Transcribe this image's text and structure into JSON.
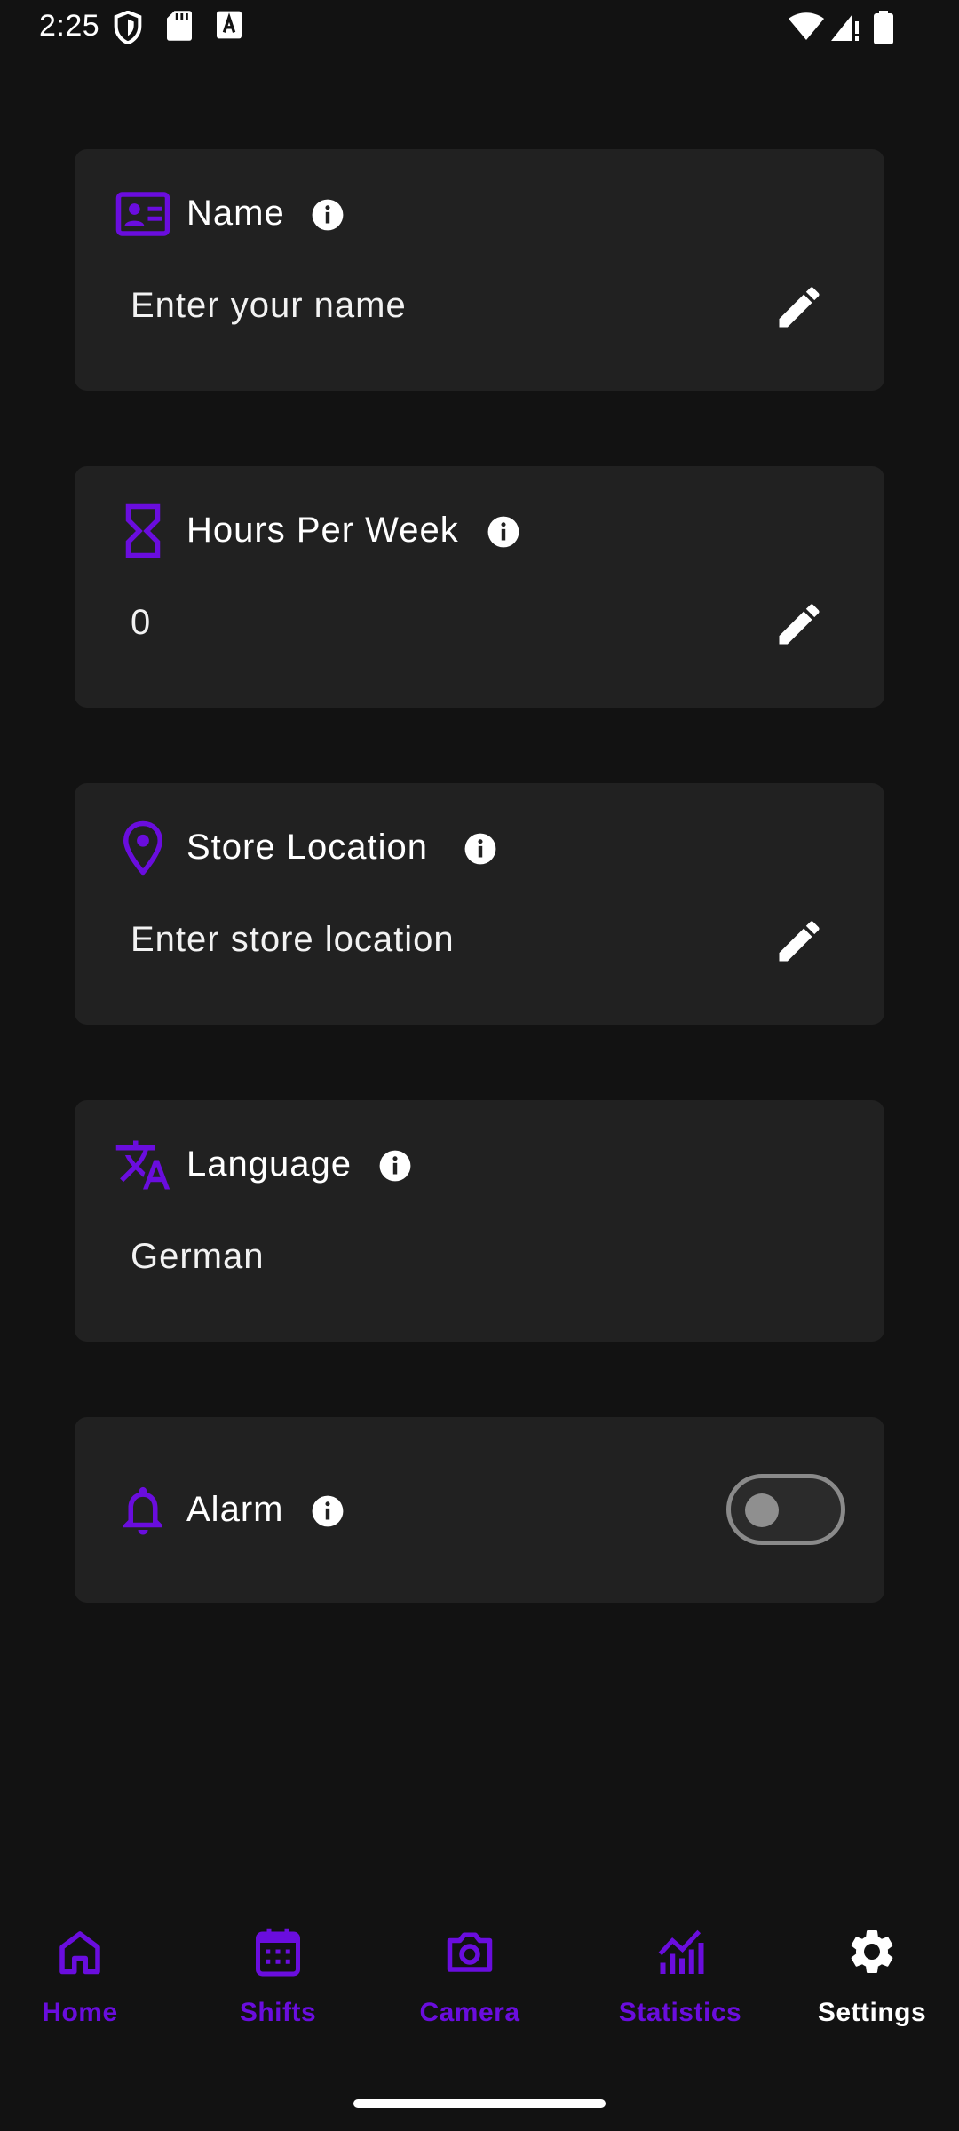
{
  "status_bar": {
    "time": "2:25",
    "left_icons": [
      "shield-icon",
      "sd-card-icon",
      "keyboard-a-icon"
    ],
    "right_icons": [
      "wifi-icon",
      "signal-icon",
      "battery-icon"
    ]
  },
  "colors": {
    "accent": "#6a0dde",
    "card_bg": "#212121",
    "background": "#121212",
    "selected_nav": "#ffffff"
  },
  "settings": {
    "name": {
      "icon": "id-card-icon",
      "title": "Name",
      "value": "Enter your name"
    },
    "hours": {
      "icon": "hourglass-icon",
      "title": "Hours Per Week",
      "value": "0"
    },
    "store": {
      "icon": "location-pin-icon",
      "title": "Store Location",
      "value": "Enter store location"
    },
    "language": {
      "icon": "translate-icon",
      "title": "Language",
      "value": "German"
    },
    "alarm": {
      "icon": "bell-icon",
      "title": "Alarm",
      "enabled": false
    }
  },
  "nav": {
    "items": [
      {
        "label": "Home",
        "icon": "home-icon",
        "selected": false
      },
      {
        "label": "Shifts",
        "icon": "calendar-icon",
        "selected": false
      },
      {
        "label": "Camera",
        "icon": "camera-icon",
        "selected": false
      },
      {
        "label": "Statistics",
        "icon": "statistics-icon",
        "selected": false
      },
      {
        "label": "Settings",
        "icon": "gear-icon",
        "selected": true
      }
    ]
  }
}
